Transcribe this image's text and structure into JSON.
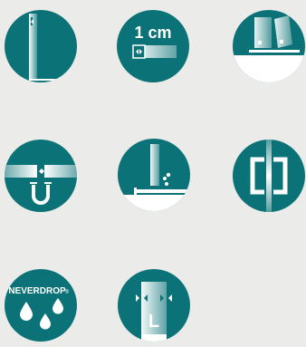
{
  "colors": {
    "teal": "#0b7377",
    "white": "#ffffff",
    "background": "#ebebea"
  },
  "icons": [
    {
      "name": "glass-panel-wall-profile-icon"
    },
    {
      "name": "one-cm-adjustment-icon",
      "label": "1 cm"
    },
    {
      "name": "hinged-glass-door-icon"
    },
    {
      "name": "magnetic-seal-icon"
    },
    {
      "name": "water-tray-drops-icon"
    },
    {
      "name": "door-handle-icon"
    },
    {
      "name": "neverdrop-coating-icon",
      "label": "NEVERDROP",
      "mark": "®"
    },
    {
      "name": "l-size-adjustable-icon",
      "label": "L"
    }
  ]
}
